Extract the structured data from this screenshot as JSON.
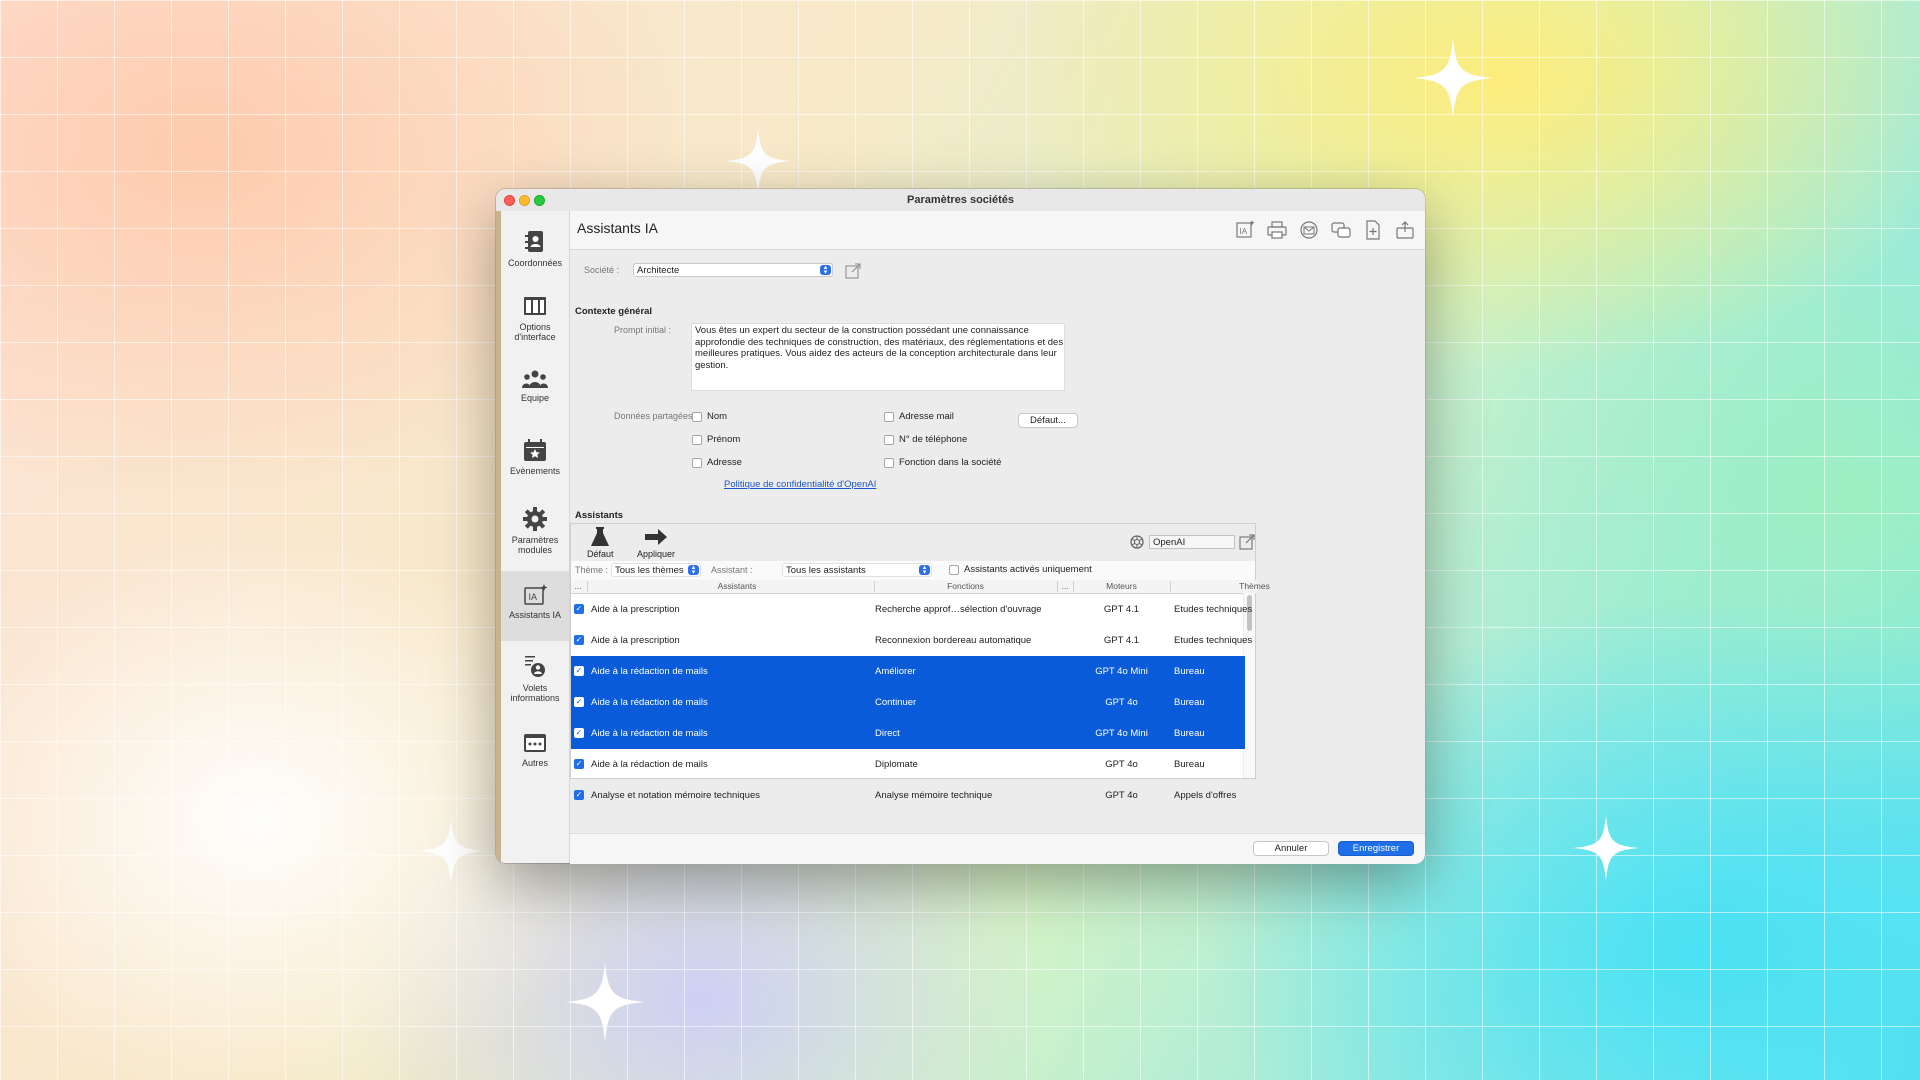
{
  "window": {
    "title": "Paramètres sociétés"
  },
  "sidebar": {
    "items": [
      {
        "label": "Coordonnées",
        "icon": "address-book-icon"
      },
      {
        "label": "Options d'interface",
        "icon": "interface-options-icon"
      },
      {
        "label": "Equipe",
        "icon": "team-icon"
      },
      {
        "label": "Evènements",
        "icon": "calendar-icon"
      },
      {
        "label": "Paramètres modules",
        "icon": "gear-icon"
      },
      {
        "label": "Assistants IA",
        "icon": "ai-assistant-icon",
        "active": true
      },
      {
        "label": "Volets informations",
        "icon": "info-panels-icon"
      },
      {
        "label": "Autres",
        "icon": "other-icon"
      }
    ]
  },
  "header": {
    "title": "Assistants IA"
  },
  "company": {
    "label": "Société :",
    "value": "Architecte"
  },
  "context": {
    "section_title": "Contexte général",
    "prompt_label": "Prompt initial :",
    "prompt_text": "Vous êtes un expert du secteur de la construction possédant une connaissance approfondie des techniques de construction, des matériaux, des réglementations et des meilleures pratiques. Vous aidez des acteurs de la conception architecturale dans leur gestion.",
    "default_button": "Défaut...",
    "shared_label": "Données partagées :",
    "shared_fields_col1": [
      "Nom",
      "Prénom",
      "Adresse"
    ],
    "shared_fields_col2": [
      "Adresse mail",
      "N° de téléphone",
      "Fonction dans la société"
    ],
    "privacy_link": "Politique de confidentialité d'OpenAI"
  },
  "assistants": {
    "section_title": "Assistants",
    "toolbar": {
      "default_label": "Défaut",
      "apply_label": "Appliquer",
      "provider": "OpenAI"
    },
    "filters": {
      "theme_label": "Thème :",
      "theme_value": "Tous les thèmes",
      "assistant_label": "Assistant :",
      "assistant_value": "Tous les assistants",
      "active_only_label": "Assistants activés uniquement"
    },
    "columns": {
      "dots1": "...",
      "assistants": "Assistants",
      "fonctions": "Fonctions",
      "dots2": "...",
      "moteurs": "Moteurs",
      "themes": "Thèmes"
    },
    "rows": [
      {
        "assistant": "Aide à la prescription",
        "fonction": "Recherche approf…sélection d'ouvrage",
        "moteur": "GPT 4.1",
        "theme": "Etudes techniques",
        "selected": false
      },
      {
        "assistant": "Aide à la prescription",
        "fonction": "Reconnexion bordereau automatique",
        "moteur": "GPT 4.1",
        "theme": "Etudes techniques",
        "selected": false
      },
      {
        "assistant": "Aide à la rédaction de mails",
        "fonction": "Améliorer",
        "moteur": "GPT 4o Mini",
        "theme": "Bureau",
        "selected": true
      },
      {
        "assistant": "Aide à la rédaction de mails",
        "fonction": "Continuer",
        "moteur": "GPT 4o",
        "theme": "Bureau",
        "selected": true
      },
      {
        "assistant": "Aide à la rédaction de mails",
        "fonction": "Direct",
        "moteur": "GPT 4o Mini",
        "theme": "Bureau",
        "selected": true
      },
      {
        "assistant": "Aide à la rédaction de mails",
        "fonction": "Diplomate",
        "moteur": "GPT 4o",
        "theme": "Bureau",
        "selected": false
      },
      {
        "assistant": "Analyse et notation mémoire techniques",
        "fonction": "Analyse mémoire technique",
        "moteur": "GPT 4o",
        "theme": "Appels d'offres",
        "selected": false
      }
    ]
  },
  "footer": {
    "cancel": "Annuler",
    "save": "Enregistrer"
  },
  "colors": {
    "accent": "#1e6fe8",
    "selection": "#0a5bd9",
    "sidebar_strip": "#c8b391"
  }
}
